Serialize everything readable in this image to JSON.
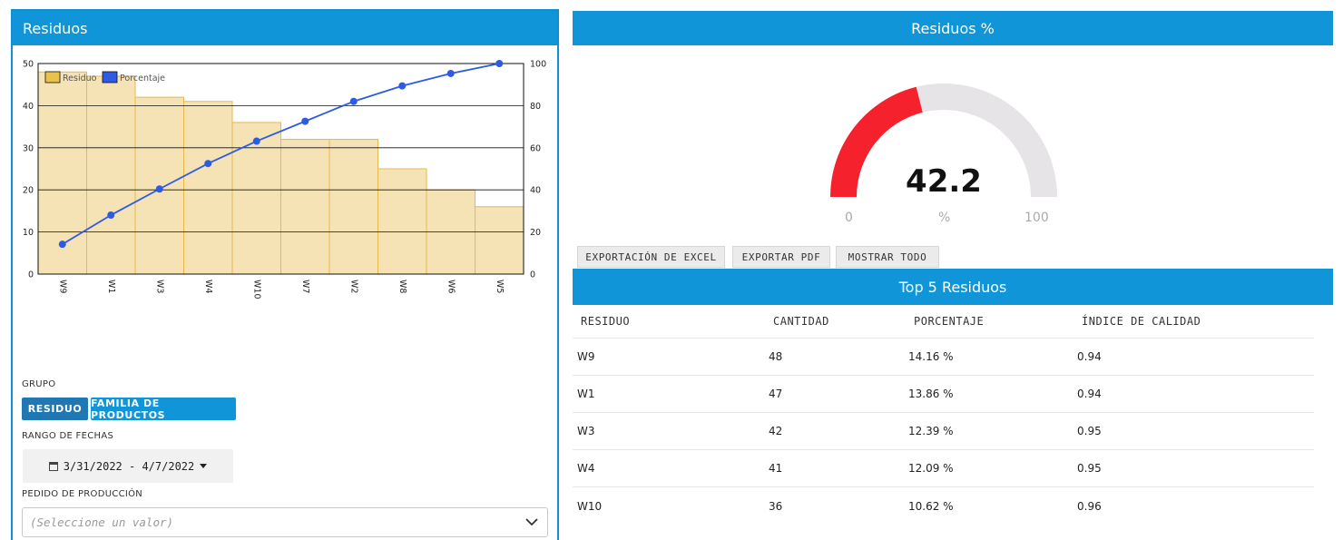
{
  "left_panel": {
    "title": "Residuos",
    "grupo_label": "GRUPO",
    "group_buttons": [
      "RESIDUO",
      "FAMILIA DE PRODUCTOS"
    ],
    "rango_label": "RANGO DE FECHAS",
    "date_range": "3/31/2022 - 4/7/2022",
    "pedido_label": "PEDIDO DE PRODUCCIÓN",
    "pedido_placeholder": "(Seleccione un valor)"
  },
  "chart_data": {
    "type": "bar",
    "categories": [
      "W9",
      "W1",
      "W3",
      "W4",
      "W10",
      "W7",
      "W2",
      "W8",
      "W6",
      "W5"
    ],
    "series": [
      {
        "name": "Residuo",
        "type": "bar",
        "axis": "left",
        "color": "#f5e3b5",
        "values": [
          48,
          47,
          42,
          41,
          36,
          32,
          32,
          25,
          20,
          16
        ]
      },
      {
        "name": "Porcentaje",
        "type": "line",
        "axis": "right",
        "color": "#2d5be3",
        "values": [
          14.16,
          28.02,
          40.41,
          52.5,
          63.12,
          72.57,
          82.01,
          89.38,
          95.28,
          100
        ]
      }
    ],
    "ylim": [
      0,
      50
    ],
    "y2lim": [
      0,
      100
    ],
    "yticks": [
      0,
      10,
      20,
      30,
      40,
      50
    ],
    "y2ticks": [
      0,
      20,
      40,
      60,
      80,
      100
    ],
    "legend": "top-left",
    "grid": true
  },
  "gauge": {
    "title": "Residuos %",
    "value": "42.2",
    "fraction": 0.422,
    "min": "0",
    "max": "100",
    "unit": "%",
    "fill_color": "#f5222d",
    "track_color": "#e6e4e6"
  },
  "export_buttons": [
    "EXPORTACIÓN DE EXCEL",
    "EXPORTAR PDF",
    "MOSTRAR TODO"
  ],
  "top5": {
    "title": "Top 5 Residuos",
    "columns": [
      "RESIDUO",
      "CANTIDAD",
      "PORCENTAJE",
      "ÍNDICE DE CALIDAD"
    ],
    "rows": [
      [
        "W9",
        "48",
        "14.16 %",
        "0.94"
      ],
      [
        "W1",
        "47",
        "13.86 %",
        "0.94"
      ],
      [
        "W3",
        "42",
        "12.39 %",
        "0.95"
      ],
      [
        "W4",
        "41",
        "12.09 %",
        "0.95"
      ],
      [
        "W10",
        "36",
        "10.62 %",
        "0.96"
      ]
    ]
  }
}
